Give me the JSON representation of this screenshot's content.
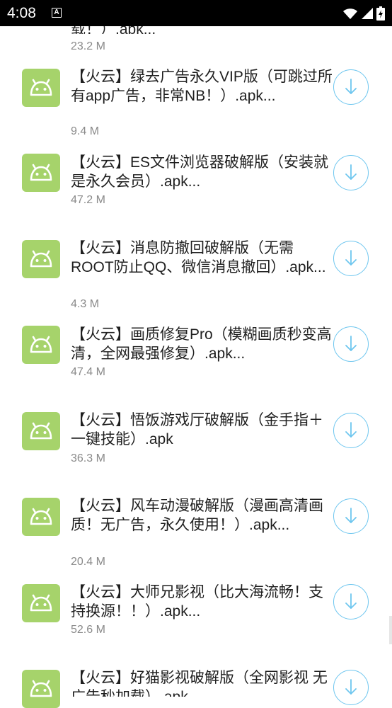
{
  "status_bar": {
    "time": "4:08",
    "notification_icon": "A"
  },
  "items": [
    {
      "title": "载！）.apk...",
      "size": "23.2 M"
    },
    {
      "title": "【火云】绿去广告永久VIP版（可跳过所有app广告，非常NB！）.apk...",
      "size": "9.4 M"
    },
    {
      "title": "【火云】ES文件浏览器破解版（安装就是永久会员）.apk...",
      "size": "47.2 M"
    },
    {
      "title": "【火云】消息防撤回破解版（无需ROOT防止QQ、微信消息撤回）.apk...",
      "size": "4.3 M"
    },
    {
      "title": "【火云】画质修复Pro（模糊画质秒变高清，全网最强修复）.apk...",
      "size": "47.4 M"
    },
    {
      "title": "【火云】悟饭游戏厅破解版（金手指＋一键技能）.apk",
      "size": "36.3 M"
    },
    {
      "title": "【火云】风车动漫破解版（漫画高清画质！无广告，永久使用！）.apk...",
      "size": "20.4 M"
    },
    {
      "title": "【火云】大师兄影视（比大海流畅！支持换源！！）.apk...",
      "size": "52.6 M"
    },
    {
      "title": "【火云】好猫影视破解版（全网影视 无广告秒加载）.apk",
      "size": ""
    }
  ]
}
